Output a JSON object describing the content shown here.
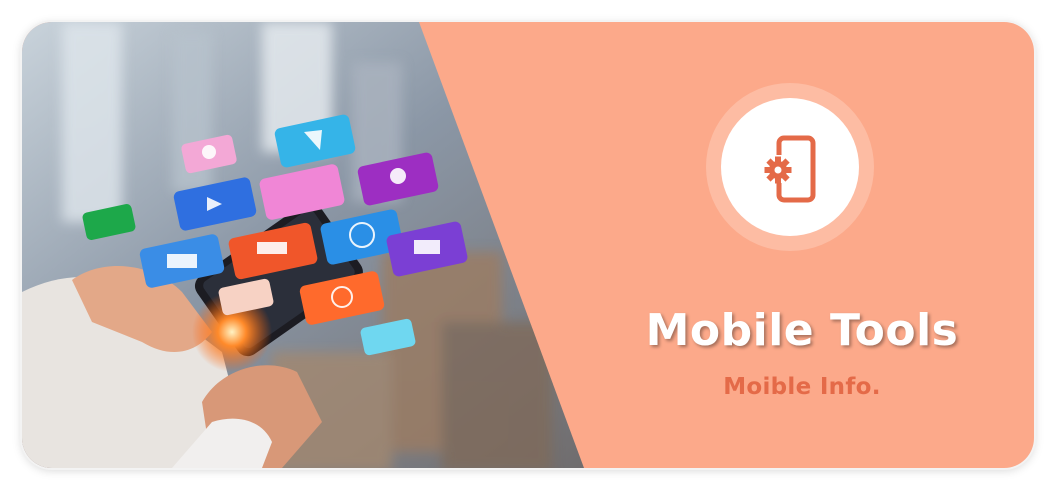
{
  "banner": {
    "title": "Mobile Tools",
    "subtitle": "Moible Info.",
    "icon": "mobile-settings-icon",
    "colors": {
      "panel": "#fca98a",
      "ring": "#fdbca3",
      "accent": "#e46a48",
      "title": "#ffffff"
    }
  }
}
